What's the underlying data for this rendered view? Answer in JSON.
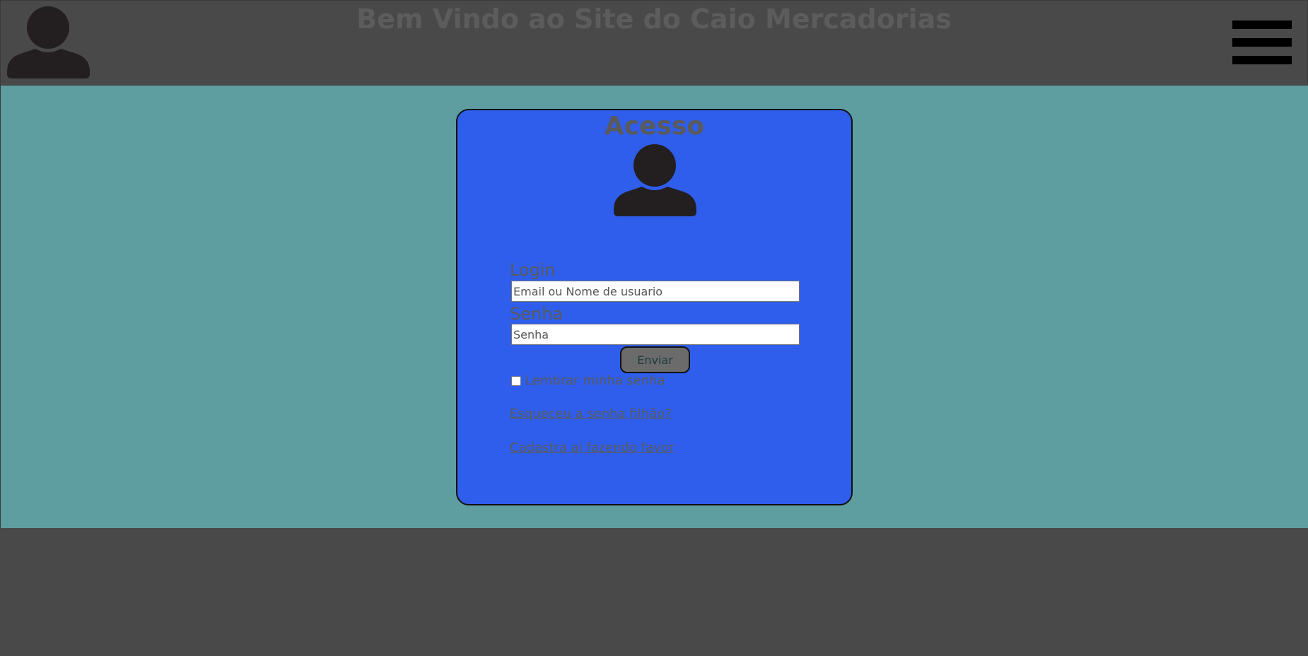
{
  "header": {
    "title": "Bem Vindo ao Site do Caio Mercadorias",
    "avatar_icon": "user-icon",
    "menu_icon": "hamburger-menu-icon"
  },
  "login_card": {
    "title": "Acesso",
    "avatar_icon": "user-icon",
    "login_label": "Login",
    "login_placeholder": "Email ou Nome de usuario",
    "password_label": "Senha",
    "password_placeholder": "Senha",
    "submit_label": "Enviar",
    "remember_label": "Lembrar minha senha",
    "forgot_link": "Esqueceu a senha filhão?",
    "register_link": "Cadastra ai fazendo favor"
  },
  "colors": {
    "header_bg": "#494949",
    "main_bg": "#5f9ea0",
    "card_bg": "#2f5eec",
    "text_gray": "#5a5a5a"
  }
}
